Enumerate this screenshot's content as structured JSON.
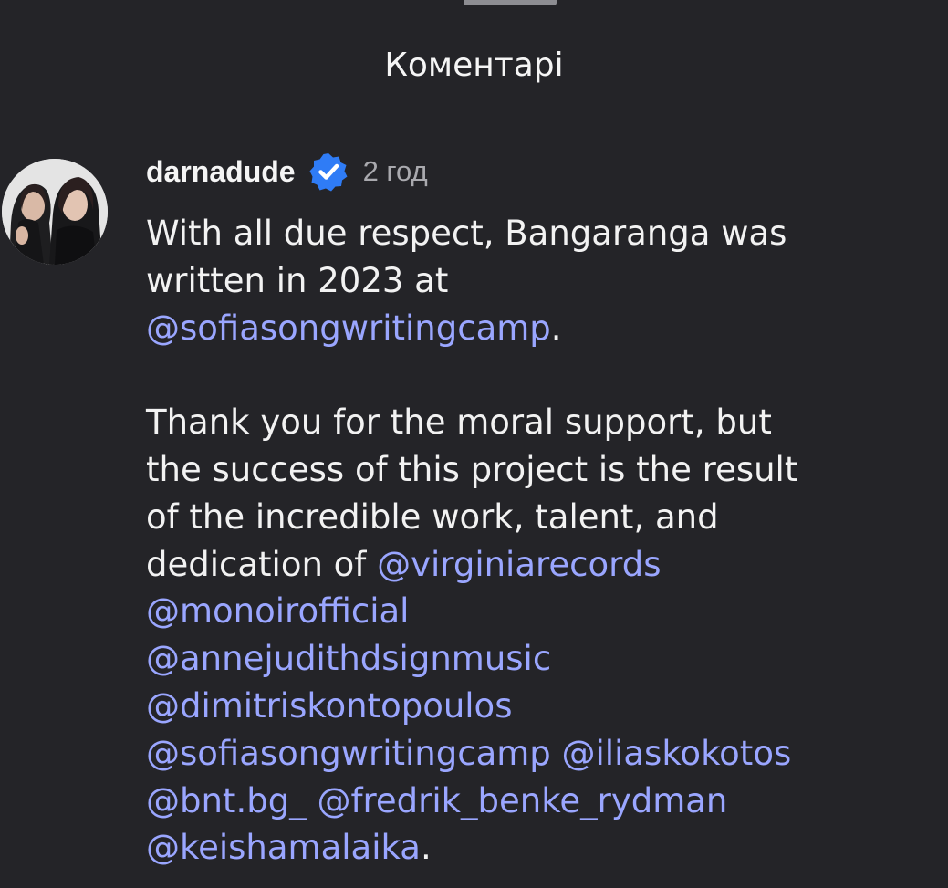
{
  "sheet": {
    "title": "Коментарі"
  },
  "comment": {
    "username": "darnadude",
    "verified_icon": "verified-badge-icon",
    "timestamp": "2 год",
    "paragraph1": {
      "line1": "With all due respect, Bangaranga was",
      "line2": "written in 2023 at",
      "mention": "@sofiasongwritingcamp",
      "end": "."
    },
    "paragraph2": {
      "line1": "Thank you for the moral support, but",
      "line2": "the success of this project is the result",
      "line3": "of the incredible work, talent, and",
      "line4_text": "dedication of ",
      "mentions": [
        "@virginiarecords",
        "@monoirofficial",
        "@annejudithdsignmusic",
        "@dimitriskontopoulos",
        "@sofiasongwritingcamp",
        "@iliaskokotos",
        "@bnt.bg_",
        "@fredrik_benke_rydman",
        "@keishamalaika"
      ],
      "end": "."
    }
  },
  "colors": {
    "background": "#242428",
    "text": "#f2f2f2",
    "muted": "#a9a9ae",
    "mention": "#9aa6ff",
    "verified": "#2f7cf6"
  }
}
